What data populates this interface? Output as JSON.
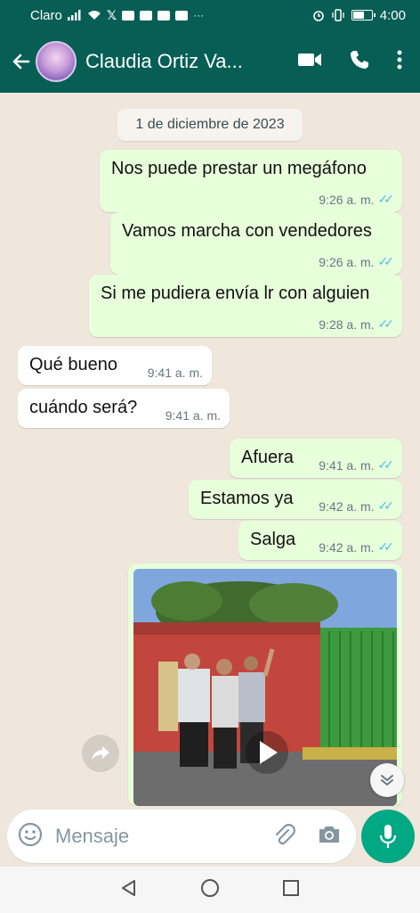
{
  "status_bar": {
    "carrier": "Claro",
    "time": "4:00",
    "battery_level": 0.55
  },
  "header": {
    "contact_name": "Claudia Ortiz Va...",
    "icons": [
      "back-arrow-icon",
      "video-call-icon",
      "phone-icon",
      "more-options-icon"
    ]
  },
  "chat": {
    "date_chip": "1 de diciembre de 2023",
    "messages": [
      {
        "direction": "out",
        "text": "Nos puede prestar un megáfono",
        "time": "9:26 a. m."
      },
      {
        "direction": "out",
        "text": "Vamos marcha con vendedores",
        "time": "9:26 a. m."
      },
      {
        "direction": "out",
        "text": "Si me pudiera envía lr con alguien",
        "time": "9:28 a. m."
      },
      {
        "direction": "in",
        "text": "Qué bueno",
        "time": "9:41 a. m."
      },
      {
        "direction": "in",
        "text": "cuándo será?",
        "time": "9:41 a. m."
      },
      {
        "direction": "out",
        "text": "Afuera",
        "time": "9:41 a. m."
      },
      {
        "direction": "out",
        "text": "Estamos ya",
        "time": "9:42 a. m."
      },
      {
        "direction": "out",
        "text": "Salga",
        "time": "9:42 a. m."
      }
    ]
  },
  "composer": {
    "placeholder": "Mensaje"
  },
  "colors": {
    "header": "#075e54",
    "outgoing_bubble": "#e7ffdb",
    "incoming_bubble": "#ffffff",
    "read_ticks": "#53bdeb",
    "mic_button": "#00a884",
    "chat_background": "#efe6dc"
  }
}
